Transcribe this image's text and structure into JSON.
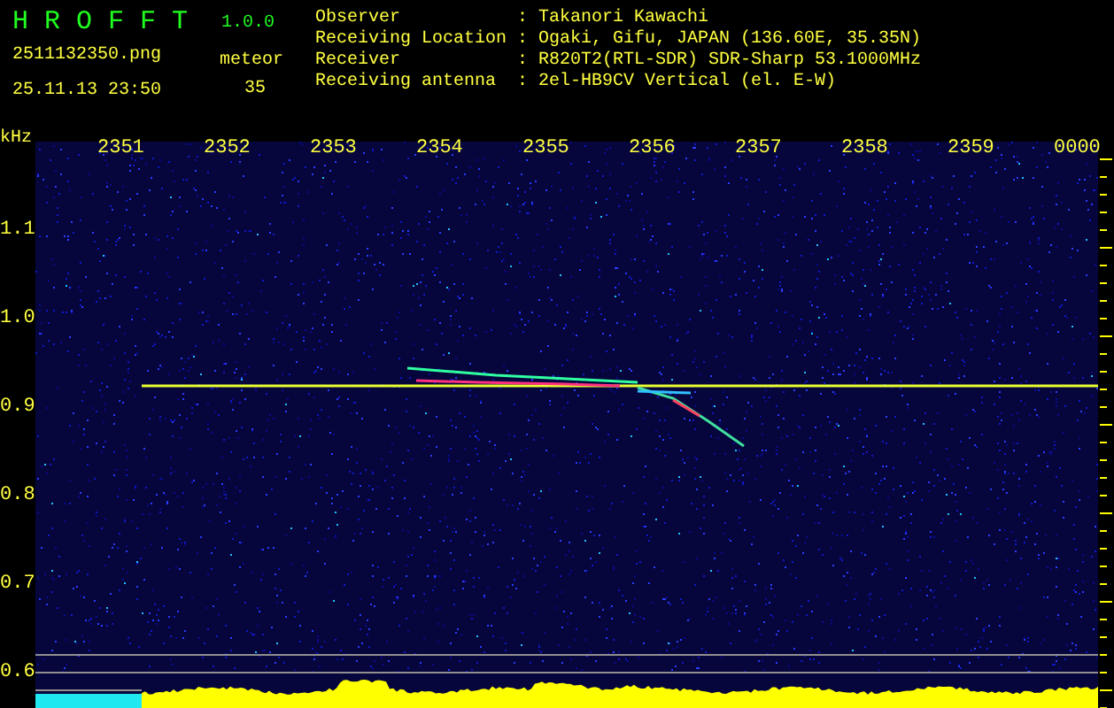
{
  "app": {
    "name": "H R O F F T",
    "version": "1.0.0"
  },
  "file": {
    "name": "2511132350.png",
    "timestamp": "25.11.13 23:50"
  },
  "meteor": {
    "label": "meteor",
    "count": "35"
  },
  "info": [
    {
      "label": "Observer",
      "separator": ":",
      "value": "Takanori Kawachi"
    },
    {
      "label": "Receiving Location",
      "separator": ":",
      "value": "Ogaki, Gifu, JAPAN (136.60E, 35.35N)"
    },
    {
      "label": "Receiver",
      "separator": ":",
      "value": "R820T2(RTL-SDR) SDR-Sharp 53.1000MHz"
    },
    {
      "label": "Receiving antenna",
      "separator": ":",
      "value": "2el-HB9CV Vertical (el. E-W)"
    }
  ],
  "spectrogram": {
    "y_unit": "kHz",
    "time_labels": [
      "2351",
      "2352",
      "2353",
      "2354",
      "2355",
      "2356",
      "2357",
      "2358",
      "2359",
      "0000"
    ],
    "frequency_labels": [
      "1.1",
      "1.0",
      "0.9",
      "0.8",
      "0.7",
      "0.6"
    ]
  }
}
